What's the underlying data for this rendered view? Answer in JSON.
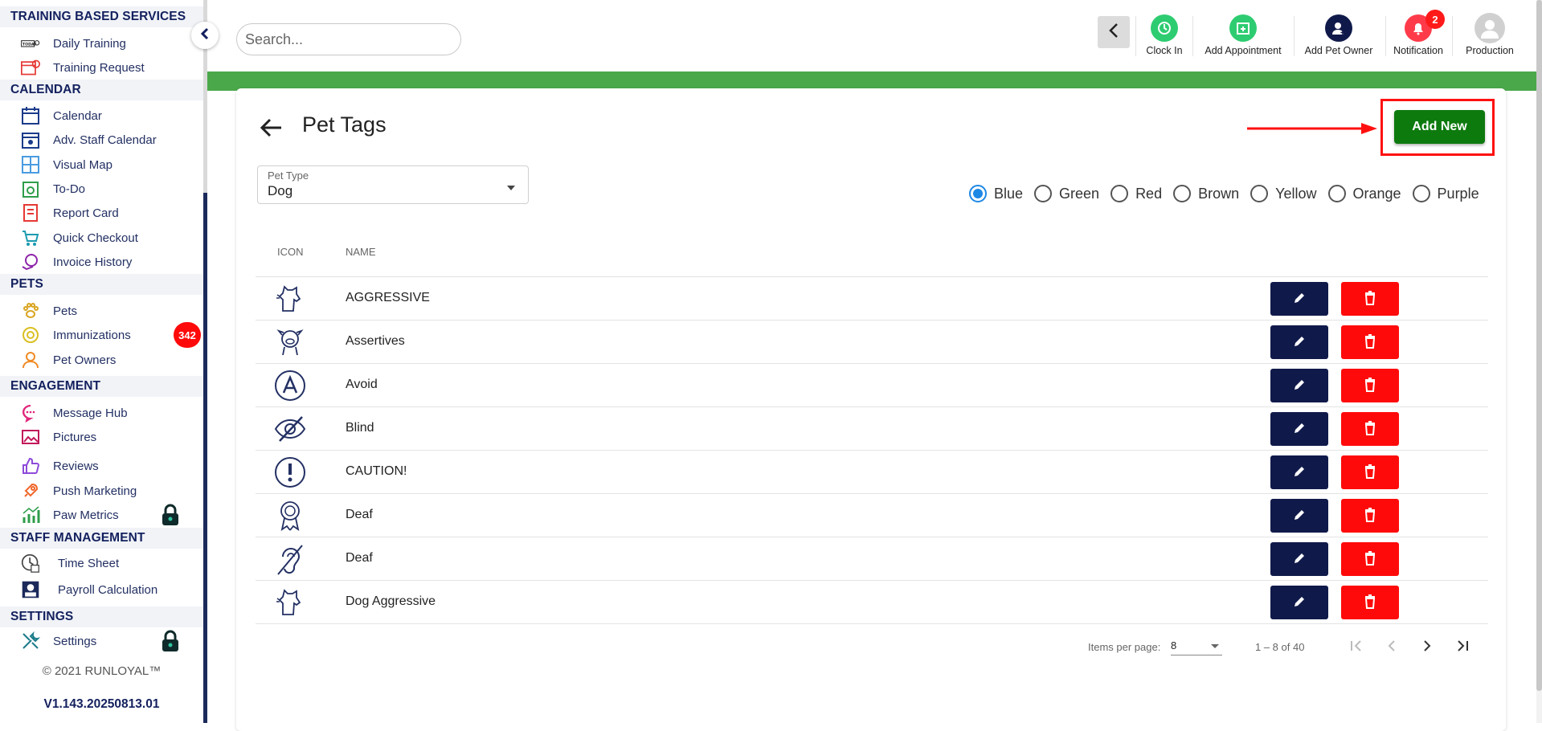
{
  "sidebar": {
    "sections": [
      {
        "title": "TRAINING BASED SERVICES"
      },
      {
        "title": "CALENDAR"
      },
      {
        "title": "PETS"
      },
      {
        "title": "ENGAGEMENT"
      },
      {
        "title": "STAFF MANAGEMENT"
      },
      {
        "title": "SETTINGS"
      }
    ],
    "items": [
      {
        "label": "Daily Training",
        "icon": "today-icon"
      },
      {
        "label": "Training Request",
        "icon": "calendar-request-icon"
      },
      {
        "label": "Calendar",
        "icon": "calendar-icon"
      },
      {
        "label": "Adv. Staff Calendar",
        "icon": "staff-calendar-icon"
      },
      {
        "label": "Visual Map",
        "icon": "grid-map-icon"
      },
      {
        "label": "To-Do",
        "icon": "todo-icon"
      },
      {
        "label": "Report Card",
        "icon": "report-card-icon"
      },
      {
        "label": "Quick Checkout",
        "icon": "cart-icon"
      },
      {
        "label": "Invoice History",
        "icon": "invoice-icon"
      },
      {
        "label": "Pets",
        "icon": "paw-icon"
      },
      {
        "label": "Immunizations",
        "icon": "immunization-icon"
      },
      {
        "label": "Pet Owners",
        "icon": "person-icon"
      },
      {
        "label": "Message Hub",
        "icon": "chat-icon"
      },
      {
        "label": "Pictures",
        "icon": "image-icon"
      },
      {
        "label": "Reviews",
        "icon": "thumbs-up-icon"
      },
      {
        "label": "Push Marketing",
        "icon": "rocket-icon"
      },
      {
        "label": "Paw Metrics",
        "icon": "bar-chart-icon"
      },
      {
        "label": "Time Sheet",
        "icon": "clock-sheet-icon"
      },
      {
        "label": "Payroll Calculation",
        "icon": "payroll-icon"
      },
      {
        "label": "Settings",
        "icon": "tools-icon"
      }
    ],
    "immunizations_badge": "342",
    "copyright": "© 2021  RUNLOYAL™",
    "version": "V1.143.20250813.01"
  },
  "header": {
    "search_placeholder": "Search...",
    "buttons": [
      {
        "label": "Clock In",
        "icon": "clock-icon",
        "color": "#2ecc71"
      },
      {
        "label": "Add Appointment",
        "icon": "add-calendar-icon",
        "color": "#2ecc71"
      },
      {
        "label": "Add Pet Owner",
        "icon": "add-person-icon",
        "color": "#101a4a"
      },
      {
        "label": "Notification",
        "icon": "bell-icon",
        "color": "#ff3b4a"
      },
      {
        "label": "Production",
        "icon": "avatar-icon",
        "color": "#d0d0d0"
      }
    ],
    "notification_count": "2"
  },
  "page": {
    "title": "Pet Tags",
    "add_new_label": "Add New",
    "pet_type": {
      "label": "Pet Type",
      "value": "Dog"
    },
    "colors": [
      "Blue",
      "Green",
      "Red",
      "Brown",
      "Yellow",
      "Orange",
      "Purple"
    ],
    "selected_color": "Blue",
    "columns": {
      "icon": "ICON",
      "name": "NAME"
    },
    "rows": [
      {
        "name": "AGGRESSIVE",
        "icon": "aggressive-dog-icon"
      },
      {
        "name": "Assertives",
        "icon": "assertive-dog-icon"
      },
      {
        "name": "Avoid",
        "icon": "letter-a-icon"
      },
      {
        "name": "Blind",
        "icon": "eye-slash-icon"
      },
      {
        "name": "CAUTION!",
        "icon": "exclamation-icon"
      },
      {
        "name": "Deaf",
        "icon": "ribbon-icon"
      },
      {
        "name": "Deaf",
        "icon": "ear-slash-icon"
      },
      {
        "name": "Dog Aggressive",
        "icon": "aggressive-dog-icon"
      }
    ],
    "pagination": {
      "items_per_page_label": "Items per page:",
      "items_per_page": "8",
      "range": "1 – 8 of 40"
    }
  },
  "colors": {
    "accent_green": "#4aa84a",
    "add_new": "#0d7a0d",
    "edit": "#101a4a",
    "delete": "#ff0a0a",
    "highlight": "#ff1010"
  }
}
